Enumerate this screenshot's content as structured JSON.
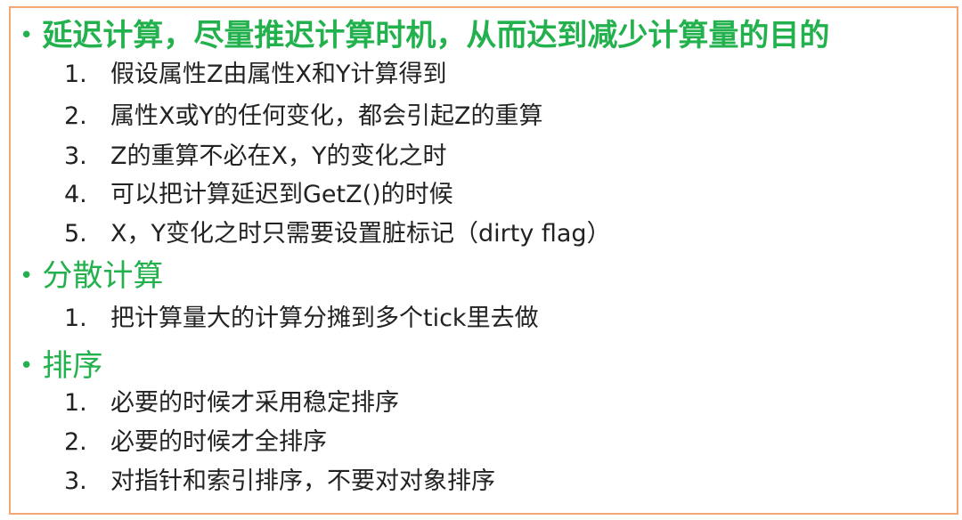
{
  "sections": [
    {
      "title": "延迟计算，尽量推迟计算时机，从而达到减少计算量的目的",
      "items": [
        {
          "num": "1.",
          "text": "假设属性Z由属性X和Y计算得到"
        },
        {
          "num": "2.",
          "text": "属性X或Y的任何变化，都会引起Z的重算"
        },
        {
          "num": "3.",
          "text": "Z的重算不必在X，Y的变化之时"
        },
        {
          "num": "4.",
          "text": "可以把计算延迟到GetZ()的时候"
        },
        {
          "num": "5.",
          "text": "X，Y变化之时只需要设置脏标记（dirty flag）"
        }
      ]
    },
    {
      "title": "分散计算",
      "items": [
        {
          "num": "1.",
          "text": "把计算量大的计算分摊到多个tick里去做"
        }
      ]
    },
    {
      "title": "排序",
      "items": [
        {
          "num": "1.",
          "text": "必要的时候才采用稳定排序"
        },
        {
          "num": "2.",
          "text": "必要的时候才全排序"
        },
        {
          "num": "3.",
          "text": "对指针和索引排序，不要对对象排序"
        }
      ]
    }
  ],
  "bullet_char": "•",
  "colors": {
    "heading": "#22b14c",
    "body_text": "#222222",
    "border": "#f2a774"
  }
}
